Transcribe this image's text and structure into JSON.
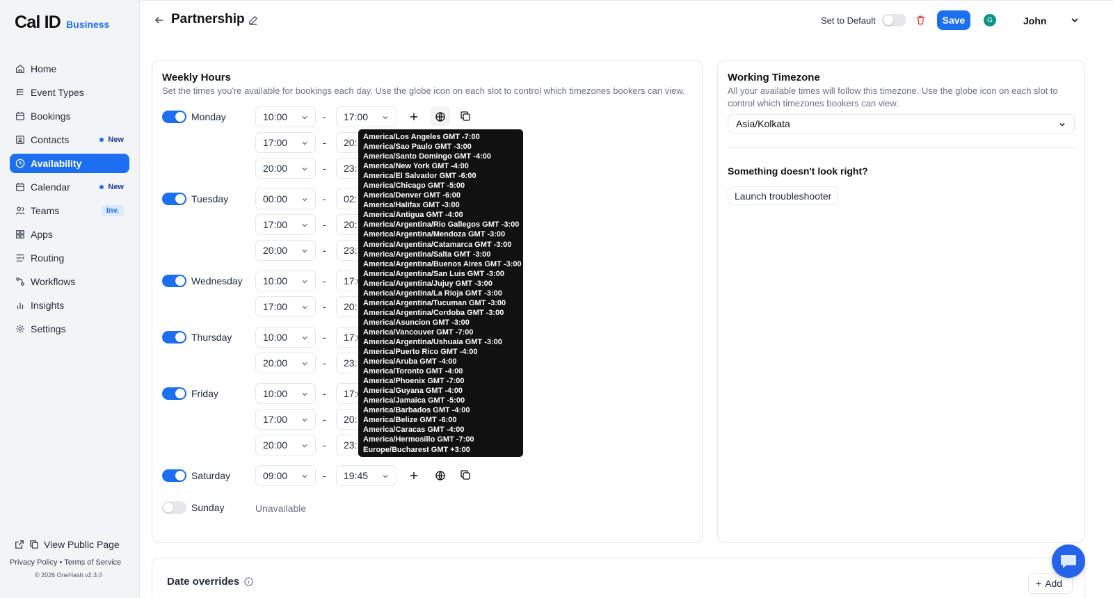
{
  "brand": {
    "name": "Cal ID",
    "tier": "Business"
  },
  "sidebar": {
    "items": [
      {
        "label": "Home",
        "icon": "home-icon"
      },
      {
        "label": "Event Types",
        "icon": "link-icon"
      },
      {
        "label": "Bookings",
        "icon": "calendar-icon"
      },
      {
        "label": "Contacts",
        "icon": "contacts-icon",
        "badge": "New"
      },
      {
        "label": "Availability",
        "icon": "clock-icon",
        "active": true
      },
      {
        "label": "Calendar",
        "icon": "calendar-icon",
        "badge": "New"
      },
      {
        "label": "Teams",
        "icon": "users-icon",
        "badge": "Inv."
      },
      {
        "label": "Apps",
        "icon": "grid-icon"
      },
      {
        "label": "Routing",
        "icon": "routing-icon"
      },
      {
        "label": "Workflows",
        "icon": "workflow-icon"
      },
      {
        "label": "Insights",
        "icon": "bar-chart-icon"
      },
      {
        "label": "Settings",
        "icon": "gear-icon"
      }
    ],
    "public_page": "View Public Page",
    "privacy": "Privacy Policy",
    "separator": "•",
    "terms": "Terms of Service",
    "copyright": "© 2026 OneHash v2.3.0"
  },
  "header": {
    "title": "Partnership",
    "set_default": "Set to Default",
    "save": "Save",
    "avatar_initial": "G",
    "user": "John"
  },
  "weekly": {
    "title": "Weekly Hours",
    "description": "Set the times you're available for bookings each day. Use the globe icon on each slot to control which timezones bookers can view.",
    "dash": "-",
    "days": [
      {
        "name": "Monday",
        "enabled": true,
        "slots": [
          [
            "10:00",
            "17:00"
          ],
          [
            "17:00",
            "20:"
          ],
          [
            "20:00",
            "23:"
          ]
        ]
      },
      {
        "name": "Tuesday",
        "enabled": true,
        "slots": [
          [
            "00:00",
            "02:"
          ],
          [
            "17:00",
            "20:"
          ],
          [
            "20:00",
            "23:"
          ]
        ]
      },
      {
        "name": "Wednesday",
        "enabled": true,
        "slots": [
          [
            "10:00",
            "17:0"
          ],
          [
            "17:00",
            "20:"
          ]
        ]
      },
      {
        "name": "Thursday",
        "enabled": true,
        "slots": [
          [
            "10:00",
            "17:0"
          ],
          [
            "20:00",
            "23:"
          ]
        ]
      },
      {
        "name": "Friday",
        "enabled": true,
        "slots": [
          [
            "10:00",
            "17:0"
          ],
          [
            "17:00",
            "20:"
          ],
          [
            "20:00",
            "23:"
          ]
        ]
      },
      {
        "name": "Saturday",
        "enabled": true,
        "slots": [
          [
            "09:00",
            "19:45"
          ]
        ]
      },
      {
        "name": "Sunday",
        "enabled": false,
        "unavailable": "Unavailable"
      }
    ]
  },
  "timezone_dropdown": [
    "America/Los Angeles GMT -7:00",
    "America/Sao Paulo GMT -3:00",
    "America/Santo Domingo GMT -4:00",
    "America/New York GMT -4:00",
    "America/El Salvador GMT -6:00",
    "America/Chicago GMT -5:00",
    "America/Denver GMT -6:00",
    "America/Halifax GMT -3:00",
    "America/Antigua GMT -4:00",
    "America/Argentina/Rio Gallegos GMT -3:00",
    "America/Argentina/Mendoza GMT -3:00",
    "America/Argentina/Catamarca GMT -3:00",
    "America/Argentina/Salta GMT -3:00",
    "America/Argentina/Buenos Aires GMT -3:00",
    "America/Argentina/San Luis GMT -3:00",
    "America/Argentina/Jujuy GMT -3:00",
    "America/Argentina/La Rioja GMT -3:00",
    "America/Argentina/Tucuman GMT -3:00",
    "America/Argentina/Cordoba GMT -3:00",
    "America/Asuncion GMT -3:00",
    "America/Vancouver GMT -7:00",
    "America/Argentina/Ushuaia GMT -3:00",
    "America/Puerto Rico GMT -4:00",
    "America/Aruba GMT -4:00",
    "America/Toronto GMT -4:00",
    "America/Phoenix GMT -7:00",
    "America/Guyana GMT -4:00",
    "America/Jamaica GMT -5:00",
    "America/Barbados GMT -4:00",
    "America/Belize GMT -6:00",
    "America/Caracas GMT -4:00",
    "America/Hermosillo GMT -7:00",
    "Europe/Bucharest GMT +3:00"
  ],
  "working_timezone": {
    "title": "Working Timezone",
    "description": "All your available times will follow this timezone. Use the globe icon on each slot to control which timezones bookers can view.",
    "value": "Asia/Kolkata",
    "help_title": "Something doesn't look right?",
    "troubleshooter": "Launch troubleshooter"
  },
  "date_overrides": {
    "title": "Date overrides",
    "add": "Add"
  },
  "colors": {
    "accent": "#1d6ff2",
    "dropdown_bg": "#111111",
    "avatar": "#0f9488"
  }
}
